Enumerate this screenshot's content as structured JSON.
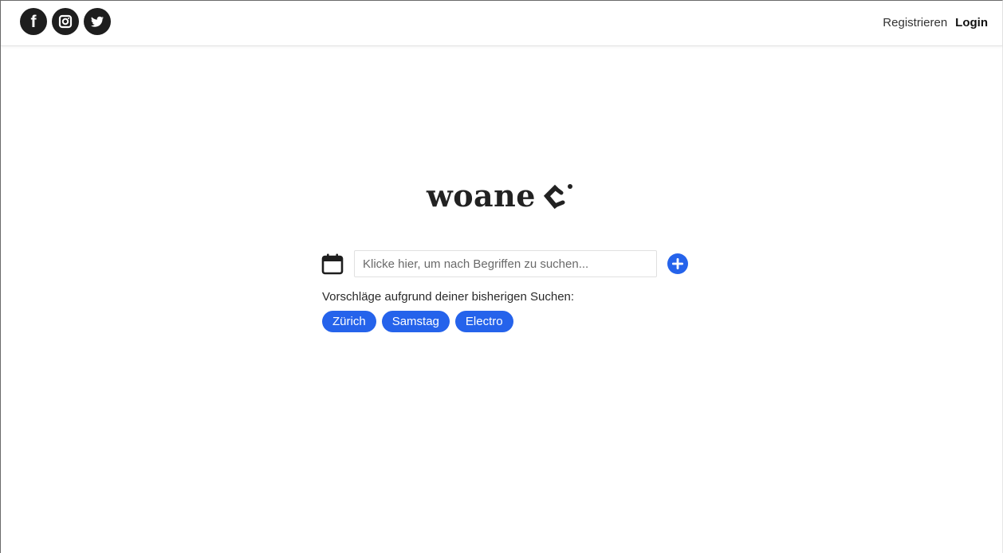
{
  "header": {
    "social": [
      {
        "name": "facebook-icon",
        "label": "f"
      },
      {
        "name": "instagram-icon"
      },
      {
        "name": "twitter-icon"
      }
    ],
    "register_label": "Registrieren",
    "login_label": "Login"
  },
  "logo": {
    "text": "woane"
  },
  "search": {
    "placeholder": "Klicke hier, um nach Begriffen zu suchen...",
    "value": ""
  },
  "suggestions": {
    "label": "Vorschläge aufgrund deiner bisherigen Suchen:",
    "chips": [
      "Zürich",
      "Samstag",
      "Electro"
    ]
  },
  "colors": {
    "accent": "#2563eb",
    "icon_dark": "#1e1e1e"
  }
}
